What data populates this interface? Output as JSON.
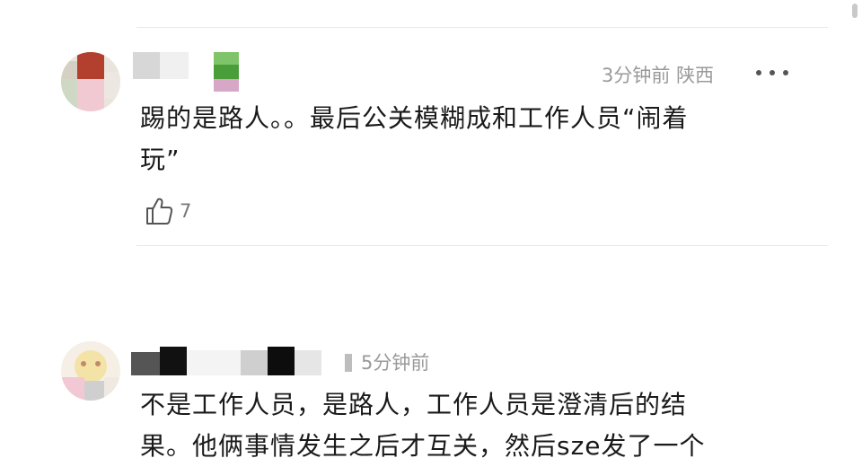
{
  "comments": [
    {
      "time": "3分钟前",
      "location": "陕西",
      "text_lines": [
        "踢的是路人。。最后公关模糊成和工作人员“闹着",
        "玩”"
      ],
      "likes": "7",
      "more_icon": "more-dots-icon",
      "like_icon": "thumbs-up-icon"
    },
    {
      "time": "5分钟前",
      "text_lines": [
        "不是工作人员，是路人，工作人员是澄清后的结",
        "果。他俩事情发生之后才互关，然后sze发了一个"
      ]
    }
  ],
  "colors": {
    "meta_gray": "#9a9a9a",
    "text": "#1a1a1a",
    "divider": "#e8e8e8"
  }
}
